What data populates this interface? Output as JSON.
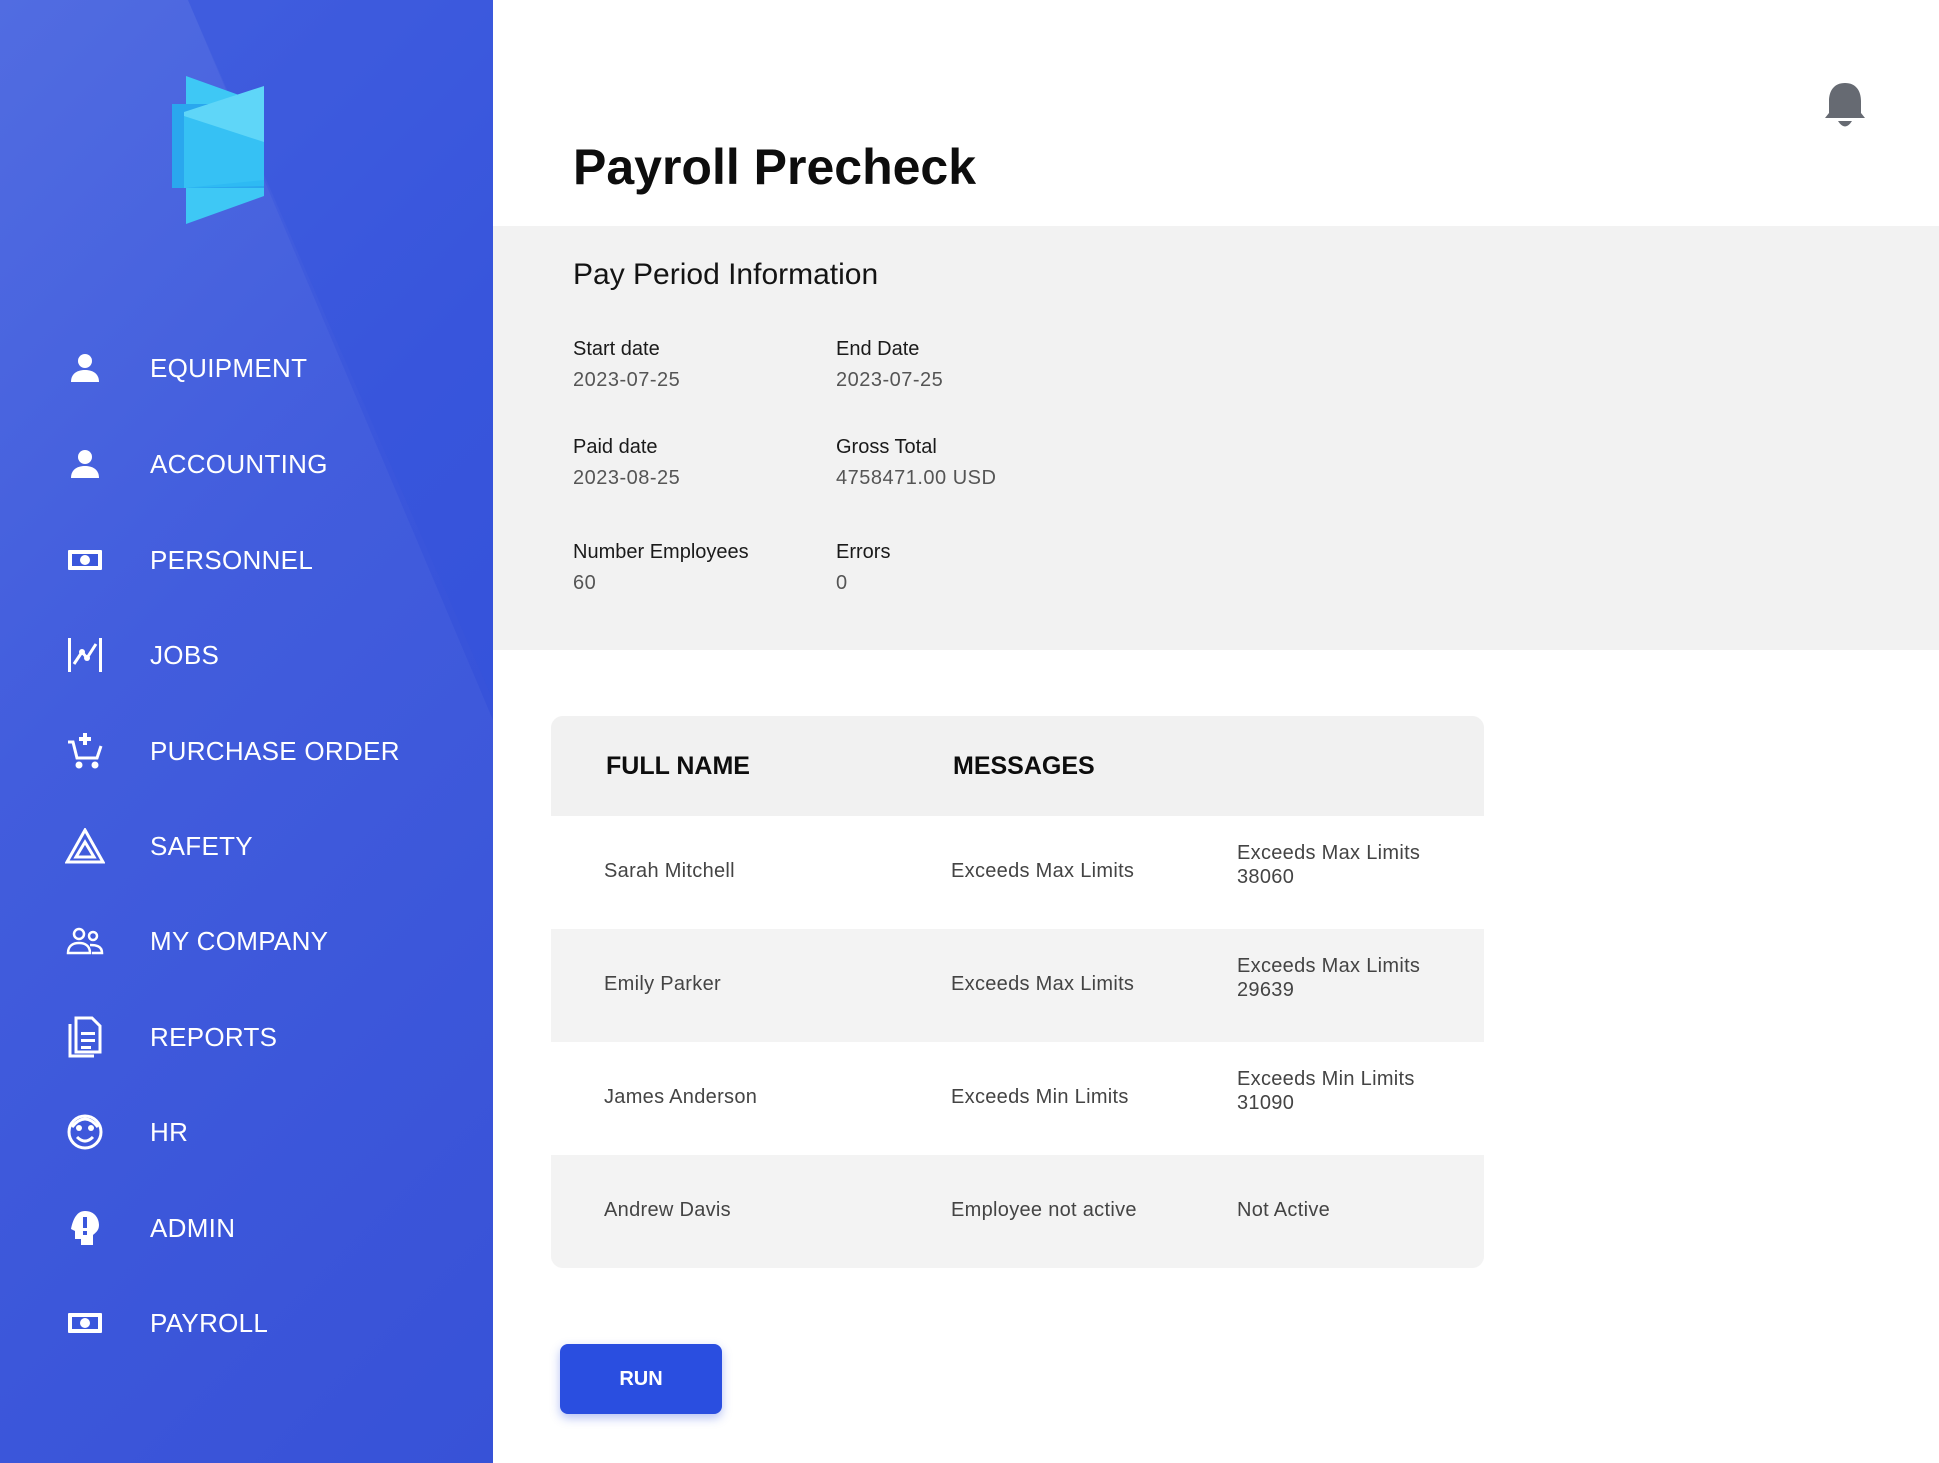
{
  "sidebar": {
    "items": [
      {
        "label": "EQUIPMENT",
        "icon": "person-icon"
      },
      {
        "label": "ACCOUNTING",
        "icon": "person-icon"
      },
      {
        "label": "PERSONNEL",
        "icon": "banknote-icon"
      },
      {
        "label": "JOBS",
        "icon": "chart-line-icon"
      },
      {
        "label": "PURCHASE ORDER",
        "icon": "cart-add-icon"
      },
      {
        "label": "SAFETY",
        "icon": "warning-triangle-icon"
      },
      {
        "label": "MY COMPANY",
        "icon": "people-icon"
      },
      {
        "label": "REPORTS",
        "icon": "document-icon"
      },
      {
        "label": "HR",
        "icon": "face-icon"
      },
      {
        "label": "ADMIN",
        "icon": "alert-head-icon"
      },
      {
        "label": "PAYROLL",
        "icon": "banknote-icon"
      }
    ]
  },
  "header": {
    "title": "Payroll Precheck",
    "notification_icon": "bell-icon"
  },
  "pay_period": {
    "title": "Pay Period Information",
    "start_date": {
      "label": "Start date",
      "value": "2023-07-25"
    },
    "end_date": {
      "label": "End Date",
      "value": "2023-07-25"
    },
    "paid_date": {
      "label": "Paid date",
      "value": "2023-08-25"
    },
    "gross_total": {
      "label": "Gross Total",
      "value": "4758471.00 USD"
    },
    "number_employees": {
      "label": "Number Employees",
      "value": "60"
    },
    "errors": {
      "label": "Errors",
      "value": "0"
    }
  },
  "table": {
    "columns": [
      "FULL NAME",
      "MESSAGES"
    ],
    "rows": [
      {
        "name": "Sarah Mitchell",
        "message": "Exceeds Max Limits",
        "detail_1": "Exceeds Max Limits",
        "detail_2": "38060"
      },
      {
        "name": "Emily Parker",
        "message": "Exceeds Max Limits",
        "detail_1": "Exceeds Max Limits",
        "detail_2": "29639"
      },
      {
        "name": "James Anderson",
        "message": "Exceeds Min Limits",
        "detail_1": "Exceeds Min Limits",
        "detail_2": "31090"
      },
      {
        "name": "Andrew Davis",
        "message": "Employee not active",
        "detail_1": "Not Active",
        "detail_2": ""
      }
    ]
  },
  "actions": {
    "run_label": "RUN"
  },
  "colors": {
    "sidebar": "#3b57dc",
    "accent": "#2a4ee0",
    "panel": "#f2f2f2"
  }
}
